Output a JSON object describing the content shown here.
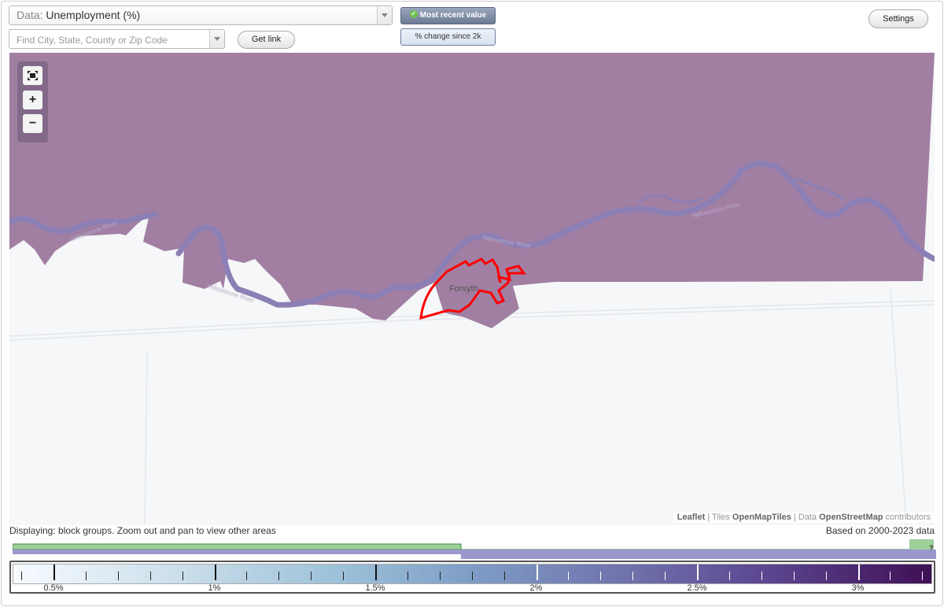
{
  "header": {
    "data_prefix": "Data:",
    "data_value": "Unemployment (%)",
    "search_placeholder": "Find City, State, County or Zip Code",
    "get_link_label": "Get link",
    "settings_label": "Settings",
    "toggle_most_recent": "Most recent value",
    "toggle_change": "% change since 2k"
  },
  "map": {
    "place_label": "Forsyth",
    "river_labels": [
      "Yellowstone River",
      "Yellowstone River",
      "Yellowstone River",
      "Yellowstone River"
    ],
    "region_color": "#a17fa3",
    "river_color": "#8b7fb5",
    "highlight_color": "#ff0000",
    "controls": {
      "fit_icon": "fullscreen-icon",
      "zoom_in": "+",
      "zoom_out": "−"
    }
  },
  "attribution": {
    "leaflet": "Leaflet",
    "sep1": " | Tiles ",
    "tiles": "OpenMapTiles",
    "sep2": " | Data ",
    "data": "OpenStreetMap",
    "tail": " contributors"
  },
  "status": {
    "displaying": "Displaying: block groups. Zoom out and pan to view other areas",
    "based_on": "Based on 2000-2023 data",
    "hist_marker": "?"
  },
  "legend": {
    "tick_labels": [
      "0.5%",
      "1%",
      "1.5%",
      "2%",
      "2.5%",
      "3%"
    ],
    "tick_values": [
      0.5,
      1,
      1.5,
      2,
      2.5,
      3
    ],
    "range": [
      0.4,
      3.25
    ]
  }
}
